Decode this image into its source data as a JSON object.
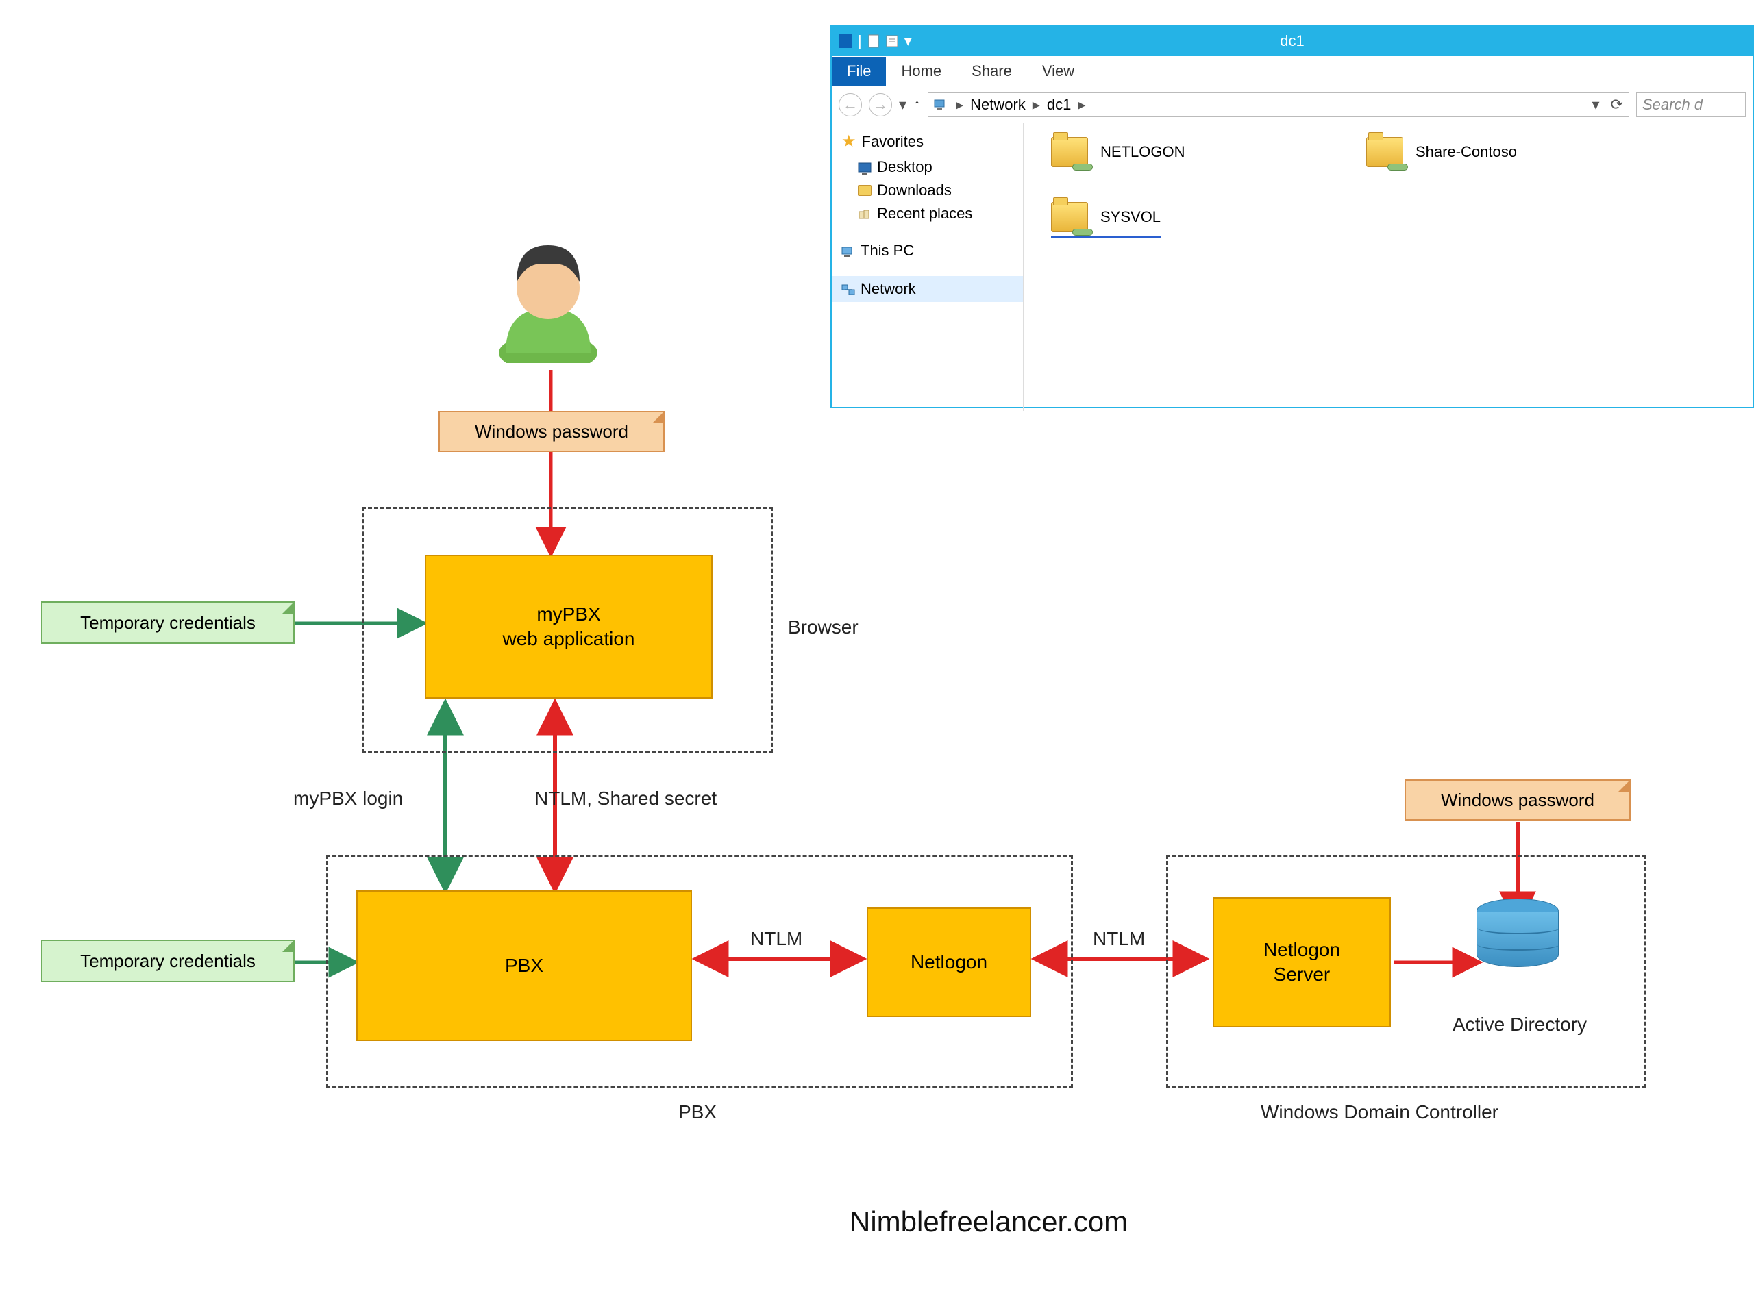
{
  "diagram": {
    "user_avatar": "user",
    "notes": {
      "windows_password_top": "Windows password",
      "windows_password_right": "Windows password",
      "temp_creds_1": "Temporary credentials",
      "temp_creds_2": "Temporary credentials"
    },
    "boxes": {
      "mypbx_app_line1": "myPBX",
      "mypbx_app_line2": "web application",
      "pbx": "PBX",
      "netlogon": "Netlogon",
      "netlogon_server_l1": "Netlogon",
      "netlogon_server_l2": "Server"
    },
    "frame_labels": {
      "browser": "Browser",
      "pbx": "PBX",
      "wdc": "Windows Domain Controller"
    },
    "edge_labels": {
      "mypbx_login": "myPBX login",
      "ntlm_shared_secret": "NTLM, Shared secret",
      "ntlm_1": "NTLM",
      "ntlm_2": "NTLM"
    },
    "db_label": "Active Directory"
  },
  "explorer": {
    "title": "dc1",
    "tabs": {
      "file": "File",
      "home": "Home",
      "share": "Share",
      "view": "View"
    },
    "breadcrumb": [
      "Network",
      "dc1"
    ],
    "search_placeholder": "Search d",
    "sidebar": {
      "favorites": "Favorites",
      "desktop": "Desktop",
      "downloads": "Downloads",
      "recent": "Recent places",
      "this_pc": "This PC",
      "network": "Network"
    },
    "folders": {
      "netlogon": "NETLOGON",
      "sysvol": "SYSVOL",
      "share_contoso": "Share-Contoso"
    }
  },
  "footer": "Nimblefreelancer.com",
  "colors": {
    "red": "#e02424",
    "green": "#2f8f5b",
    "yellow": "#ffc100",
    "note_peach": "#f9d3a6",
    "note_green": "#d6f3ce"
  }
}
